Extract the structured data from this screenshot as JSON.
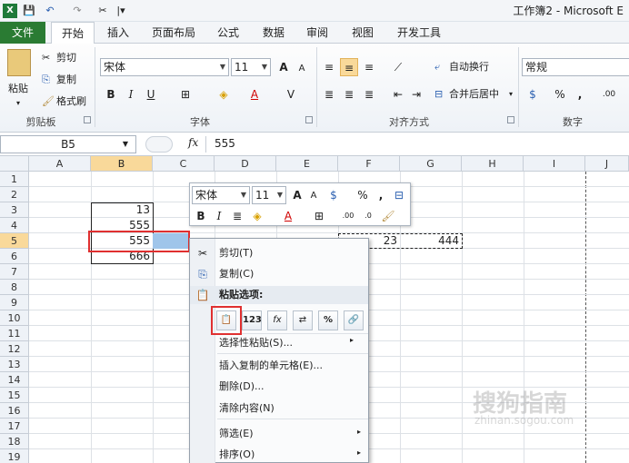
{
  "title": "工作簿2 - Microsoft E",
  "qat": {
    "excel_icon": "X",
    "save": "💾",
    "undo": "↶",
    "redo": "↷",
    "format": "✂",
    "more": "|▾"
  },
  "tabs": [
    "文件",
    "开始",
    "插入",
    "页面布局",
    "公式",
    "数据",
    "审阅",
    "视图",
    "开发工具"
  ],
  "ribbon": {
    "clipboard": {
      "paste": "粘贴",
      "cut": "剪切",
      "copy": "复制",
      "format_painter": "格式刷",
      "label": "剪贴板"
    },
    "font": {
      "name": "宋体",
      "size": "11",
      "bold": "B",
      "italic": "I",
      "underline": "U",
      "grow": "A",
      "shrink": "A",
      "label": "字体"
    },
    "align": {
      "wrap": "自动换行",
      "merge": "合并后居中",
      "label": "对齐方式"
    },
    "number": {
      "format": "常规",
      "percent": "%",
      "comma": ",",
      "label": "数字"
    }
  },
  "formula_bar": {
    "name_box": "B5",
    "fx": "fx",
    "value": "555"
  },
  "columns": [
    "A",
    "B",
    "C",
    "D",
    "E",
    "F",
    "G",
    "H",
    "I",
    "J"
  ],
  "rows": [
    "1",
    "2",
    "3",
    "4",
    "5",
    "6",
    "7",
    "8",
    "9",
    "10",
    "11",
    "12",
    "13",
    "14",
    "15",
    "16",
    "17",
    "18",
    "19"
  ],
  "cells": {
    "B3": "13",
    "B4": "555",
    "B5": "555",
    "B6": "666",
    "F5": "23",
    "G5": "444"
  },
  "mini_toolbar": {
    "font": "宋体",
    "size": "11",
    "percent": "%",
    "comma": ",",
    "bold": "B",
    "italic": "I"
  },
  "context_menu": {
    "cut": "剪切(T)",
    "copy": "复制(C)",
    "paste_options": "粘贴选项:",
    "paste_special": "选择性粘贴(S)...",
    "insert_copied": "插入复制的单元格(E)...",
    "delete": "删除(D)...",
    "clear": "清除内容(N)",
    "filter": "筛选(E)",
    "sort": "排序(O)"
  },
  "paste_buttons": [
    "📋",
    "123",
    "fx",
    "⇄",
    "%",
    "🔗"
  ],
  "watermark": {
    "main": "搜狗指南",
    "sub": "zhinan.sogou.com"
  }
}
